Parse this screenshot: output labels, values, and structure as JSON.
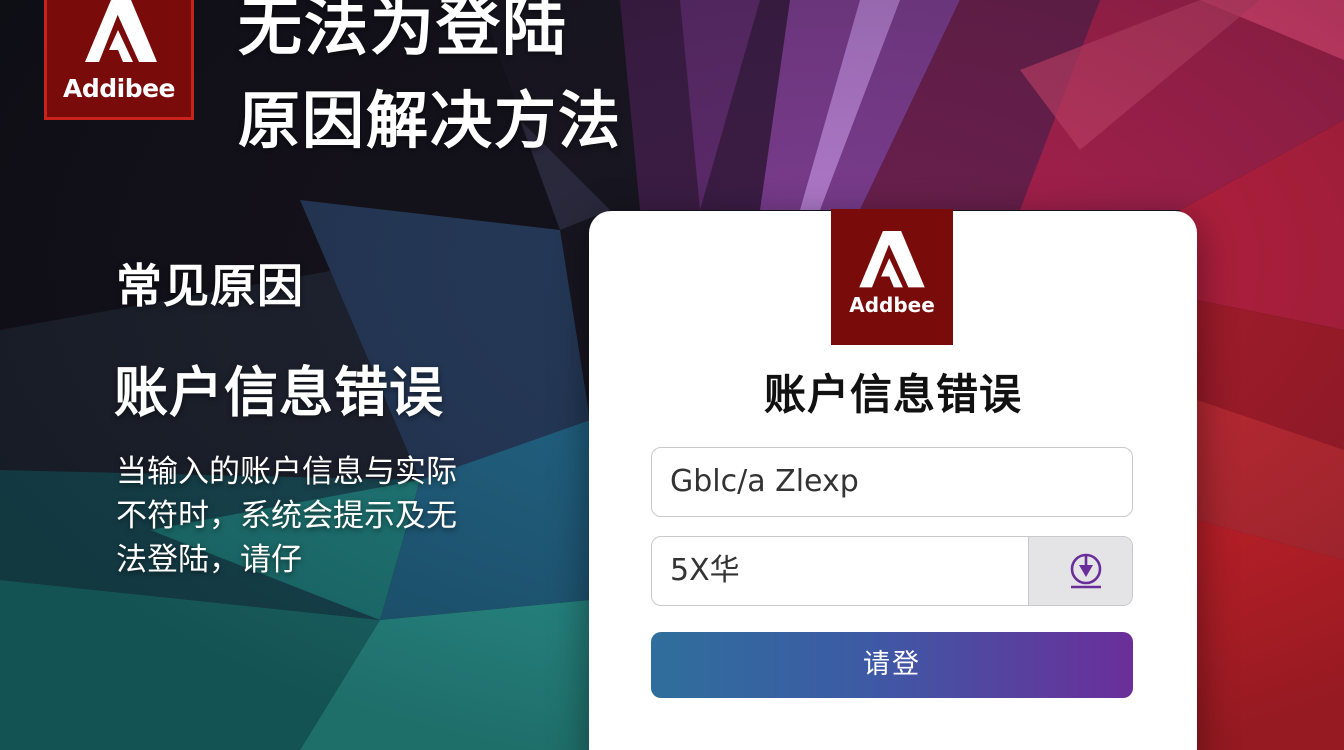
{
  "brand": {
    "logo_text": "Addibee",
    "card_logo_text": "Addbee",
    "color": "#7a0b0b"
  },
  "headline": {
    "line1": "无法为登陆",
    "line2": "原因解决方法"
  },
  "section": {
    "heading": "常见原因",
    "subheading": "账户信息错误",
    "body_lines": [
      "当输入的账户信息与实际",
      "不符时，系统会提示及无",
      "法登陆，请仔"
    ]
  },
  "login_card": {
    "title": "账户信息错误",
    "username_value": "Gblc/a Zlexp",
    "password_value": "5X华",
    "password_toggle_icon": "eye-icon",
    "submit_label": "请登",
    "button_gradient": [
      "#2f6e9c",
      "#6b2e9a"
    ]
  }
}
